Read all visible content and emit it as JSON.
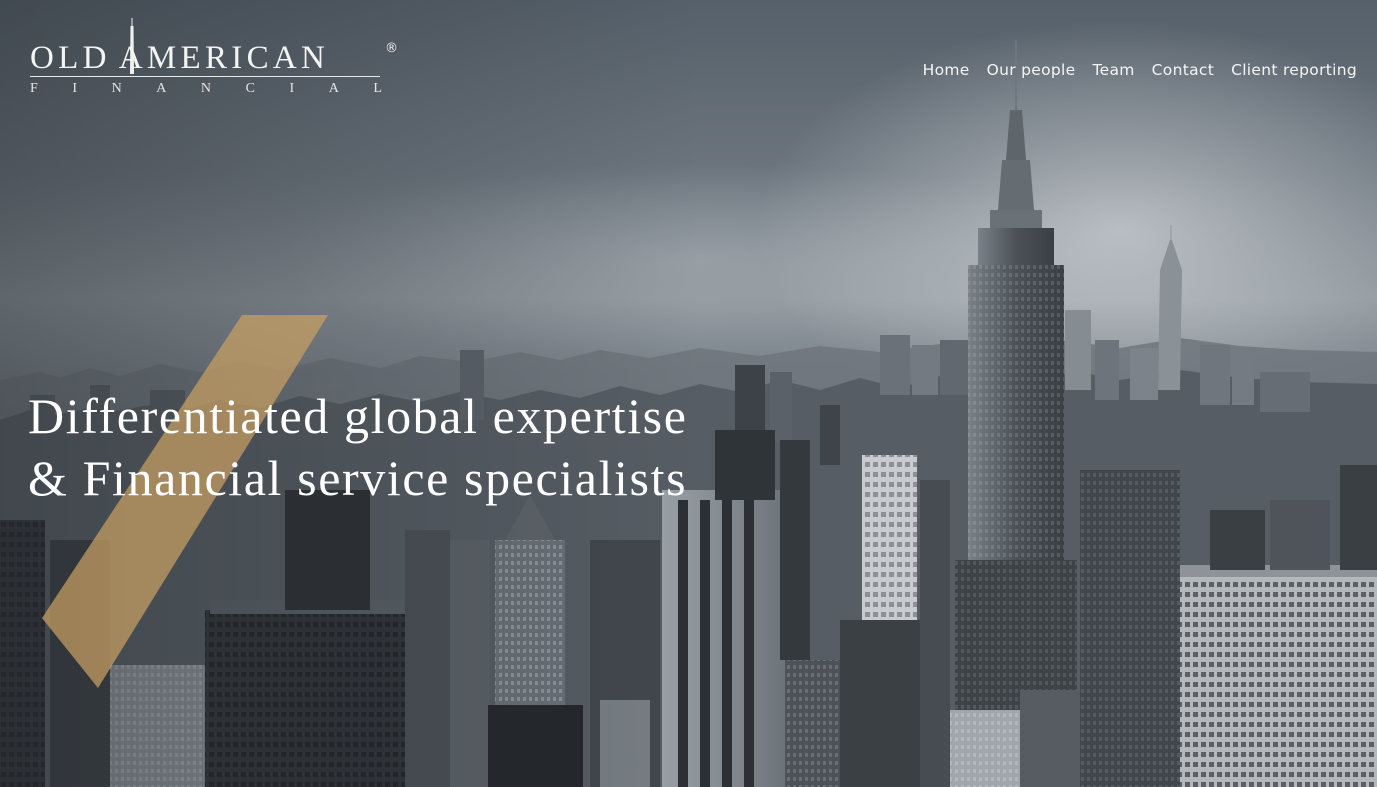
{
  "brand": {
    "name": "OLDAMERICAN",
    "name_left": "OLD",
    "name_right": "AMERICAN",
    "registered_mark": "®",
    "subtitle_letters": [
      "F",
      "I",
      "N",
      "A",
      "N",
      "C",
      "I",
      "A",
      "L"
    ]
  },
  "nav": {
    "items": [
      {
        "label": "Home"
      },
      {
        "label": "Our people"
      },
      {
        "label": "Team"
      },
      {
        "label": "Contact"
      },
      {
        "label": "Client reporting"
      }
    ]
  },
  "hero": {
    "headline_line1": "Differentiated global expertise",
    "headline_line2": "& Financial service specialists",
    "background": "city-skyline-photo",
    "accent_color": "#c9a063"
  }
}
